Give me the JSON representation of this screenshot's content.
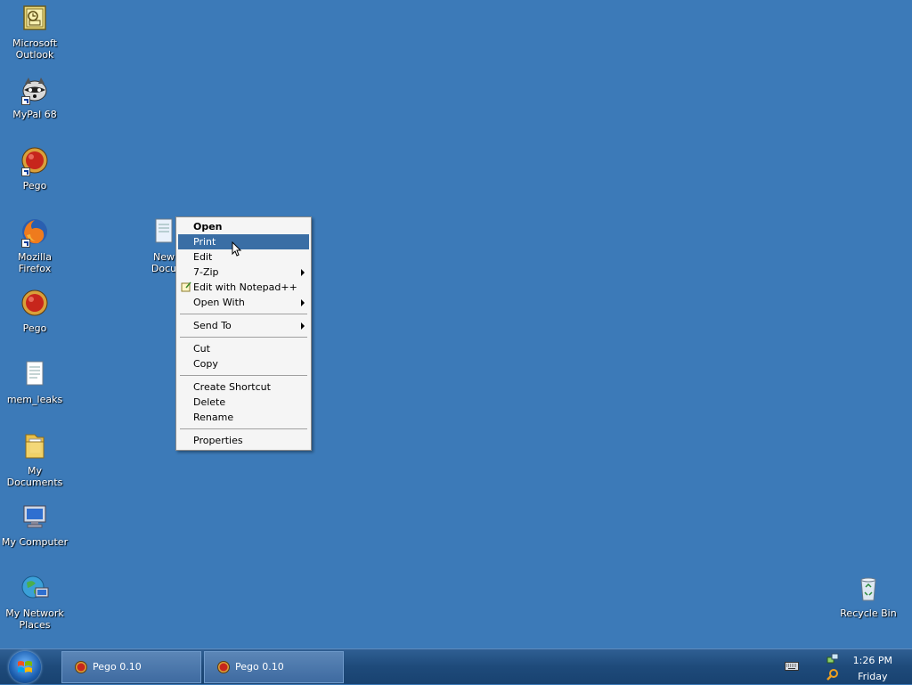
{
  "desktop": {
    "icons": [
      {
        "label": "Microsoft\nOutlook"
      },
      {
        "label": "MyPal 68"
      },
      {
        "label": "Pego"
      },
      {
        "label": "Mozilla\nFirefox"
      },
      {
        "label": "Pego"
      },
      {
        "label": "mem_leaks"
      },
      {
        "label": "My\nDocuments"
      },
      {
        "label": "My Computer"
      },
      {
        "label": "My Network\nPlaces"
      },
      {
        "label": "Recycle Bin"
      },
      {
        "label": "New\nDocu"
      }
    ]
  },
  "context_menu": {
    "items": [
      {
        "label": "Open"
      },
      {
        "label": "Print"
      },
      {
        "label": "Edit"
      },
      {
        "label": "7-Zip"
      },
      {
        "label": "Edit with Notepad++"
      },
      {
        "label": "Open With"
      },
      {
        "label": "Send To"
      },
      {
        "label": "Cut"
      },
      {
        "label": "Copy"
      },
      {
        "label": "Create Shortcut"
      },
      {
        "label": "Delete"
      },
      {
        "label": "Rename"
      },
      {
        "label": "Properties"
      }
    ]
  },
  "taskbar": {
    "buttons": [
      {
        "label": "Pego 0.10"
      },
      {
        "label": "Pego 0.10"
      }
    ],
    "clock": {
      "time": "1:26 PM",
      "day": "Friday"
    }
  },
  "colors": {
    "desktop_bg": "#3c7ab8",
    "menu_highlight": "#3a6ea5"
  }
}
